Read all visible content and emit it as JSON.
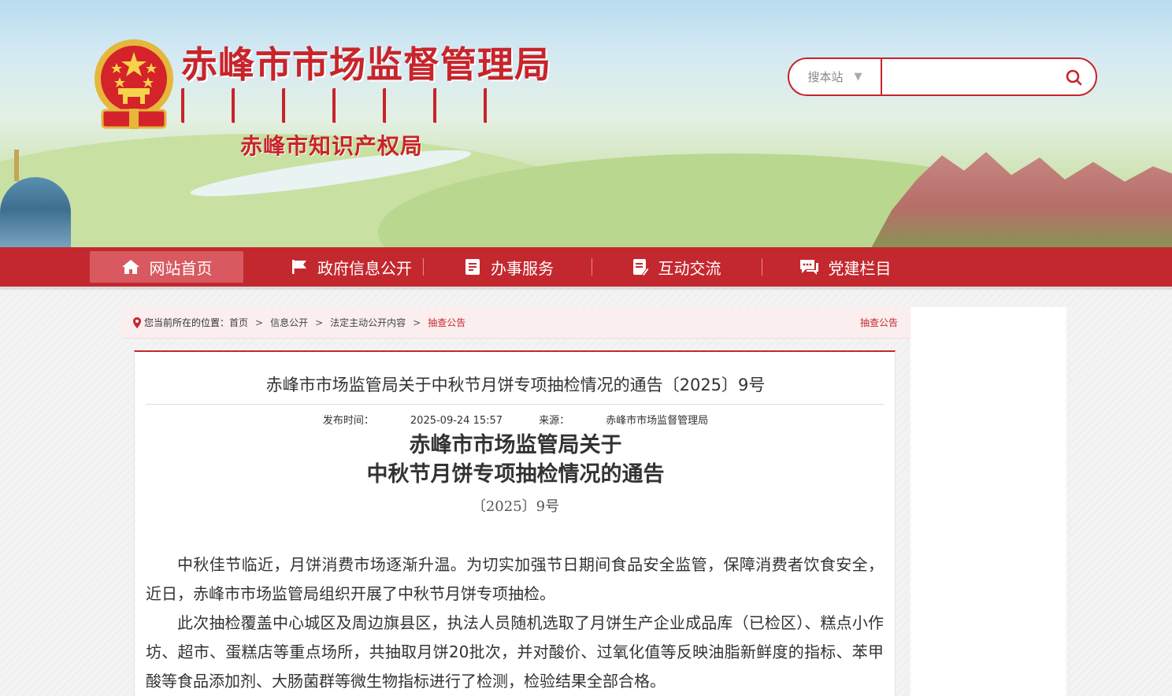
{
  "header": {
    "title": "赤峰市市场监督管理局",
    "subtitle": "赤峰市知识产权局",
    "emblem_icon": "national-emblem-icon"
  },
  "search": {
    "scope_label": "搜本站",
    "query": "",
    "placeholder": "",
    "button_icon": "search-icon"
  },
  "nav": {
    "items": [
      {
        "label": "网站首页",
        "icon": "home-icon",
        "active": true
      },
      {
        "label": "政府信息公开",
        "icon": "flag-icon"
      },
      {
        "label": "办事服务",
        "icon": "document-icon"
      },
      {
        "label": "互动交流",
        "icon": "edit-icon"
      },
      {
        "label": "党建栏目",
        "icon": "chat-icon"
      }
    ]
  },
  "breadcrumb": {
    "prefix": "您当前所在的位置：",
    "items": [
      "首页",
      "信息公开",
      "法定主动公开内容",
      "抽查公告"
    ],
    "section": "抽查公告"
  },
  "article": {
    "title": "赤峰市市场监管局关于中秋节月饼专项抽检情况的通告〔2025〕9号",
    "published_label": "发布时间：",
    "published": "2025-09-24 15:57",
    "source_label": "来源：",
    "source": "赤峰市市场监督管理局",
    "doc_title_line1": "赤峰市市场监管局关于",
    "doc_title_line2": "中秋节月饼专项抽检情况的通告",
    "doc_number": "〔2025〕9号",
    "paragraphs": [
      "中秋佳节临近，月饼消费市场逐渐升温。为切实加强节日期间食品安全监管，保障消费者饮食安全，近日，赤峰市市场监管局组织开展了中秋节月饼专项抽检。",
      "此次抽检覆盖中心城区及周边旗县区，执法人员随机选取了月饼生产企业成品库（已检区）、糕点小作坊、超市、蛋糕店等重点场所，共抽取月饼20批次，并对酸价、过氧化值等反映油脂新鲜度的指标、苯甲酸等食品添加剂、大肠菌群等微生物指标进行了检测，检验结果全部合格。"
    ]
  },
  "colors": {
    "brand_red": "#c4282f",
    "nav_active": "#d85a60",
    "breadcrumb_bg": "#fbeeee"
  }
}
